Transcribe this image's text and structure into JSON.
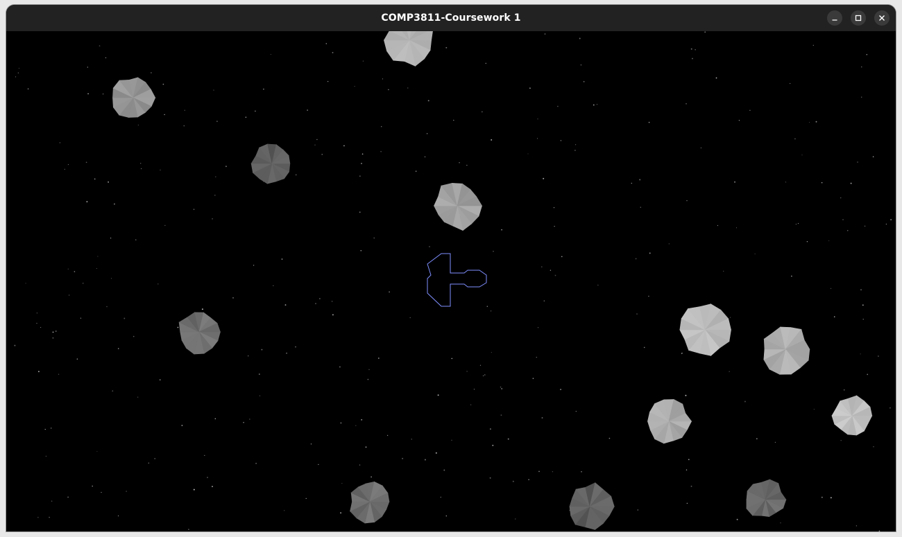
{
  "window": {
    "title": "COMP3811-Coursework 1"
  },
  "controls": {
    "minimize": "minimize-icon",
    "maximize": "maximize-icon",
    "close": "close-icon"
  },
  "scene": {
    "background_color": "#000000",
    "star_color": "#bfbfbf",
    "ship_outline_color": "#7f8fff"
  }
}
